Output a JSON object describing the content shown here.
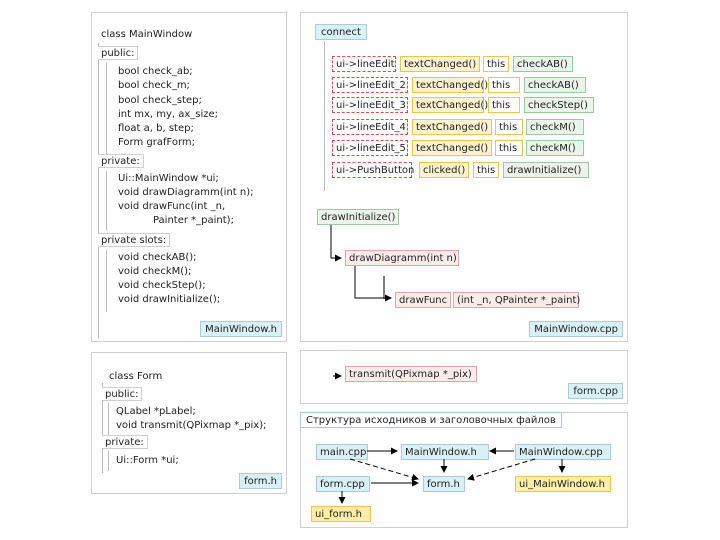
{
  "main_window_h": {
    "class_header": "class MainWindow",
    "public_label": "public:",
    "public_members": [
      "bool check_ab;",
      "bool check_m;",
      "bool check_step;",
      "int mx, my, ax_size;",
      "float a, b, step;",
      "Form grafForm;"
    ],
    "private_label": "private:",
    "private_members": [
      "Ui::MainWindow *ui;",
      "void drawDiagramm(int n);",
      "void drawFunc(int _n,",
      "           Painter *_paint);"
    ],
    "slots_label": "private slots:",
    "slot_members": [
      "void checkAB();",
      "void checkM();",
      "void checkStep();",
      "void drawInitialize();"
    ],
    "file_label": "MainWindow.h"
  },
  "main_window_cpp": {
    "header": "connect",
    "rows": [
      [
        "ui->lineEdit",
        "textChanged()",
        "this",
        "checkAB()"
      ],
      [
        "ui->lineEdit_2",
        "textChanged()",
        "this",
        "checkAB()"
      ],
      [
        "ui->lineEdit_3",
        "textChanged()",
        "this",
        "checkStep()"
      ],
      [
        "ui->lineEdit_4",
        "textChanged()",
        "this",
        "checkM()"
      ],
      [
        "ui->lineEdit_5",
        "textChanged()",
        "this",
        "checkM()"
      ],
      [
        "ui->PushButton",
        "clicked()",
        "this",
        "drawInitialize()"
      ]
    ],
    "draw_initialize": "drawInitialize()",
    "draw_diagramm": "drawDiagramm(int n)",
    "draw_func": "drawFunc",
    "draw_func_args": "(int _n, QPainter *_paint)",
    "file_label": "MainWindow.cpp"
  },
  "form_h": {
    "class_header": "class Form",
    "public_label": "public:",
    "public_members": [
      "QLabel *pLabel;",
      "void transmit(QPixmap *_pix);"
    ],
    "private_label": "private:",
    "private_members": [
      "Ui::Form *ui;"
    ],
    "file_label": "form.h"
  },
  "form_cpp": {
    "method": "transmit(QPixmap *_pix)",
    "file_label": "form.cpp"
  },
  "structure": {
    "title": "Структура исходников и заголовочных файлов",
    "nodes": {
      "main_cpp": "main.cpp",
      "mainwindow_h": "MainWindow.h",
      "mainwindow_cpp": "MainWindow.cpp",
      "form_cpp": "form.cpp",
      "form_h": "form.h",
      "ui_mainwindow_h": "ui_MainWindow.h",
      "ui_form_h": "ui_form.h"
    }
  },
  "colors": {
    "header_cyan": "#d9f0f4",
    "token_red_border": "#d05050",
    "token_yellow": "#fbf3cf",
    "token_green": "#eaf4ea",
    "token_pink": "#fbecec",
    "ui_header_yellow": "#fbeea6"
  }
}
